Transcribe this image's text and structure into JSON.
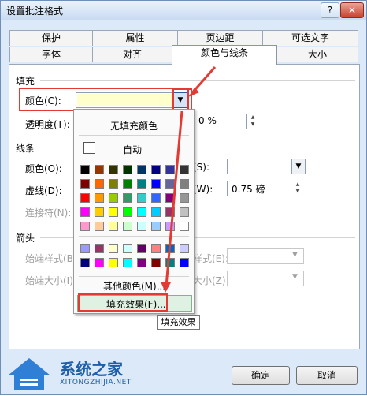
{
  "window": {
    "title": "设置批注格式"
  },
  "titlebar": {
    "help": "?",
    "close": "✕"
  },
  "tabs_row1": [
    "保护",
    "属性",
    "页边距",
    "可选文字"
  ],
  "tabs_row2": [
    "字体",
    "对齐",
    "颜色与线条",
    "大小"
  ],
  "fill": {
    "section": "填充",
    "color_label": "颜色(C):",
    "transparency_label": "透明度(T):",
    "transparency_value": "0 %"
  },
  "line": {
    "section": "线条",
    "color_label": "颜色(O):",
    "dash_label": "虚线(D):",
    "connector_label": "连接符(N):",
    "style_label": "(S):",
    "weight_label": "(W):",
    "weight_value": "0.75 磅"
  },
  "arrow": {
    "section": "箭头",
    "begin_style": "始端样式(B)",
    "begin_size": "始端大小(I):",
    "end_style": "样式(E):",
    "end_size": "大小(Z):"
  },
  "popup": {
    "no_fill": "无填充颜色",
    "auto": "自动",
    "more_colors": "其他颜色(M)...",
    "fill_effects": "填充效果(F)...",
    "grid_colors": [
      [
        "#000000",
        "#993300",
        "#333300",
        "#003300",
        "#003366",
        "#000080",
        "#333399",
        "#333333"
      ],
      [
        "#800000",
        "#FF6600",
        "#808000",
        "#008000",
        "#008080",
        "#0000FF",
        "#666699",
        "#808080"
      ],
      [
        "#FF0000",
        "#FF9900",
        "#99CC00",
        "#339966",
        "#33CCCC",
        "#3366FF",
        "#800080",
        "#969696"
      ],
      [
        "#FF00FF",
        "#FFCC00",
        "#FFFF00",
        "#00FF00",
        "#00FFFF",
        "#00CCFF",
        "#993366",
        "#C0C0C0"
      ],
      [
        "#FF99CC",
        "#FFCC99",
        "#FFFF99",
        "#CCFFCC",
        "#CCFFFF",
        "#99CCFF",
        "#CC99FF",
        "#FFFFFF"
      ]
    ],
    "extra_colors": [
      [
        "#9999FF",
        "#993366",
        "#FFFFCC",
        "#CCFFFF",
        "#660066",
        "#FF8080",
        "#0066CC",
        "#CCCCFF"
      ],
      [
        "#000080",
        "#FF00FF",
        "#FFFF00",
        "#00FFFF",
        "#800080",
        "#800000",
        "#008080",
        "#0000FF"
      ]
    ]
  },
  "tooltip": "填充效果",
  "buttons": {
    "ok": "确定",
    "cancel": "取消"
  },
  "watermark": {
    "name": "系统之家",
    "url": "XITONGZHIJIA.NET"
  }
}
